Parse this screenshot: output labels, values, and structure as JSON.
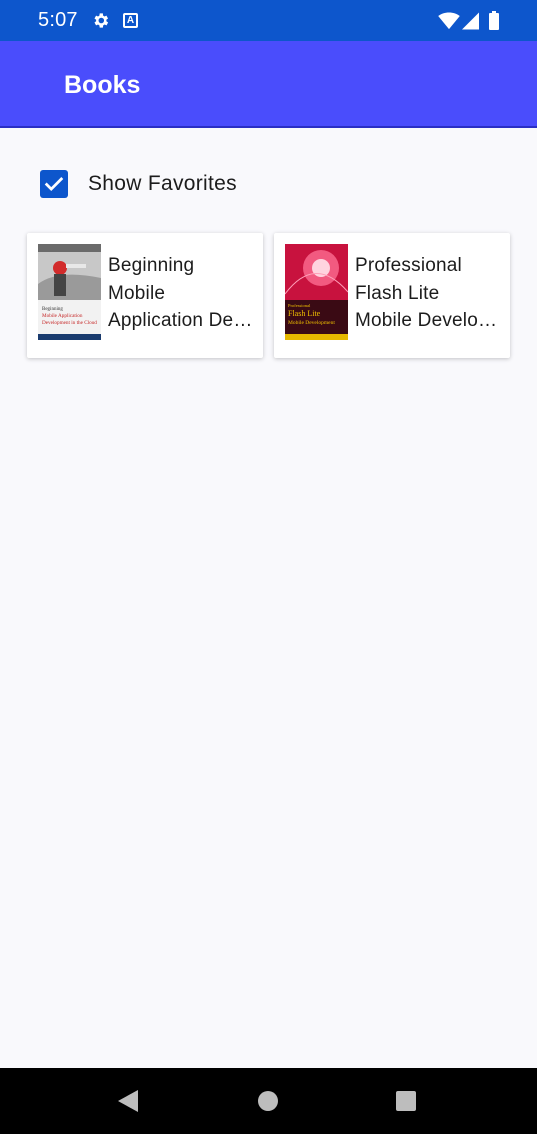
{
  "status_bar": {
    "time": "5:07",
    "icons": [
      "gear-icon",
      "text-a-icon",
      "wifi-icon",
      "signal-icon",
      "battery-icon"
    ],
    "a_glyph": "A",
    "color": "#0d56cc"
  },
  "app_bar": {
    "title": "Books",
    "color": "#4a4dfc"
  },
  "favorites": {
    "label": "Show Favorites",
    "checked": true
  },
  "books": [
    {
      "title_lines": [
        "Beginning",
        "Mobile",
        "Application Development in the Cloud"
      ],
      "cover": {
        "top_word": "Beginning",
        "lines": [
          "Mobile Application",
          "Development in the Cloud"
        ]
      }
    },
    {
      "title_lines": [
        "Professional",
        "Flash Lite",
        "Mobile Development"
      ],
      "cover": {
        "top_word": "Professional",
        "lines": [
          "Flash Lite",
          "Mobile Development"
        ]
      }
    }
  ],
  "nav_bar": {
    "icons": [
      "back-icon",
      "home-icon",
      "recents-icon"
    ]
  }
}
